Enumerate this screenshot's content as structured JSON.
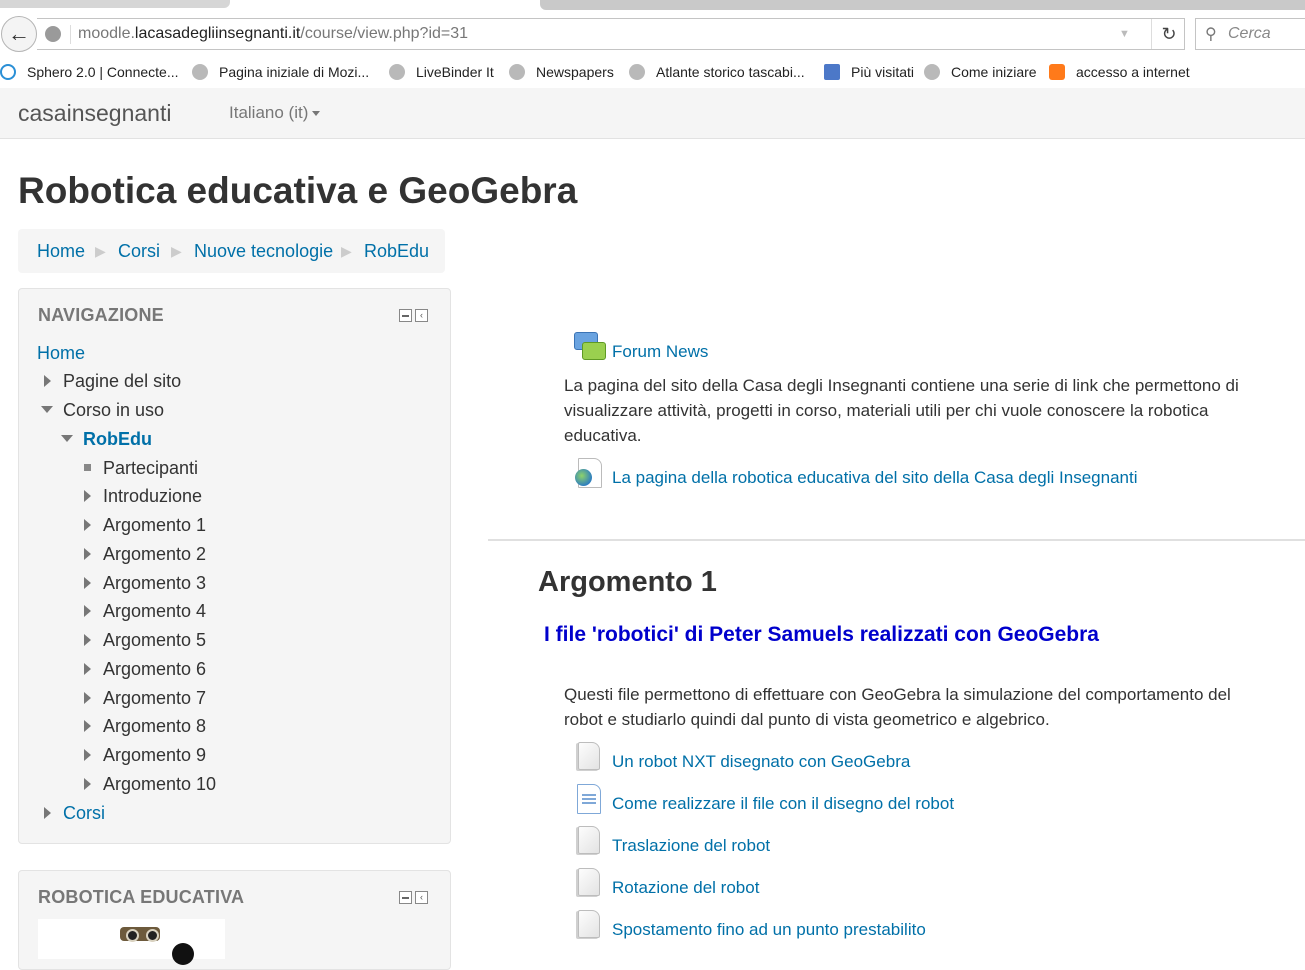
{
  "browser": {
    "url_prefix": "moodle.",
    "url_domain": "lacasadegliinsegnanti.it",
    "url_path": "/course/view.php?id=31",
    "search_placeholder": "Cerca",
    "bookmarks": [
      {
        "label": "Sphero 2.0 | Connecte...",
        "icon": "sphero-icon"
      },
      {
        "label": "Pagina iniziale di Mozi...",
        "icon": "globe-icon"
      },
      {
        "label": "LiveBinder It",
        "icon": "globe-icon"
      },
      {
        "label": "Newspapers",
        "icon": "globe-icon"
      },
      {
        "label": "Atlante storico tascabi...",
        "icon": "globe-icon"
      },
      {
        "label": "Più visitati",
        "icon": "search-folder-icon"
      },
      {
        "label": "Come iniziare",
        "icon": "globe-icon"
      },
      {
        "label": "accesso a internet",
        "icon": "lock-icon"
      }
    ]
  },
  "header": {
    "brand": "casainsegnanti",
    "language": "Italiano (it)"
  },
  "page": {
    "title": "Robotica educativa e GeoGebra",
    "breadcrumb": [
      "Home",
      "Corsi",
      "Nuove tecnologie",
      "RobEdu"
    ]
  },
  "navigation": {
    "title": "NAVIGAZIONE",
    "items": [
      {
        "label": "Home"
      },
      {
        "label": "Pagine del sito"
      },
      {
        "label": "Corso in uso"
      },
      {
        "label": "RobEdu"
      },
      {
        "label": "Partecipanti"
      },
      {
        "label": "Introduzione"
      },
      {
        "label": "Argomento 1"
      },
      {
        "label": "Argomento 2"
      },
      {
        "label": "Argomento 3"
      },
      {
        "label": "Argomento 4"
      },
      {
        "label": "Argomento 5"
      },
      {
        "label": "Argomento 6"
      },
      {
        "label": "Argomento 7"
      },
      {
        "label": "Argomento 8"
      },
      {
        "label": "Argomento 9"
      },
      {
        "label": "Argomento 10"
      },
      {
        "label": "Corsi"
      }
    ]
  },
  "robotics_block": {
    "title": "ROBOTICA EDUCATIVA"
  },
  "intro_section": {
    "forum_link": "Forum News",
    "description_line1": "La pagina del sito della Casa degli Insegnanti contiene una serie di link che permettono di",
    "description_line2": "visualizzare attività, progetti in corso, materiali utili per chi vuole conoscere la robotica",
    "description_line3": "educativa.",
    "url_link": "La pagina della robotica educativa del sito della Casa degli Insegnanti"
  },
  "section1": {
    "heading": "Argomento 1",
    "subheading": "I file 'robotici' di Peter Samuels realizzati con GeoGebra",
    "text_line1": "Questi file permettono di effettuare con GeoGebra la simulazione del comportamento del",
    "text_line2": "robot e studiarlo quindi dal punto di vista geometrico e algebrico.",
    "resources": [
      {
        "label": "Un robot NXT disegnato con GeoGebra",
        "icon": "file-icon"
      },
      {
        "label": "Come realizzare il file con il disegno del robot",
        "icon": "document-icon"
      },
      {
        "label": "Traslazione del robot",
        "icon": "file-icon"
      },
      {
        "label": "Rotazione del robot",
        "icon": "file-icon"
      },
      {
        "label": "Spostamento fino ad un punto prestabilito",
        "icon": "file-icon"
      }
    ]
  }
}
